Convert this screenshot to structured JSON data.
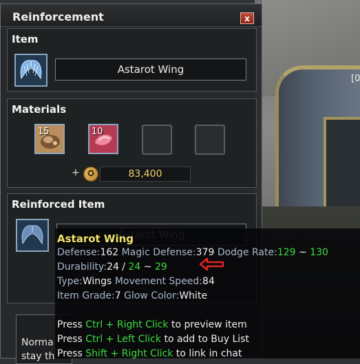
{
  "scene": {
    "corner_mark": "[0"
  },
  "window": {
    "title": "Reinforcement",
    "close_label": "x"
  },
  "item_section": {
    "title": "Item",
    "item_name": "Astarot Wing"
  },
  "materials_section": {
    "title": "Materials",
    "slots": [
      {
        "count": "15",
        "icon": "ore-icon"
      },
      {
        "count": "10",
        "icon": "crystal-icon"
      },
      {
        "count": "",
        "icon": "empty"
      },
      {
        "count": "",
        "icon": "empty"
      }
    ],
    "plus": "+",
    "cost": "83,400"
  },
  "reinforced_section": {
    "title": "Reinforced Item",
    "item_name": "Astarot Wing"
  },
  "bottom": {
    "line1": "Norma",
    "line2": "stay th"
  },
  "tooltip": {
    "title": "Astarot Wing",
    "defense_label": "Defense:",
    "defense_value": "162",
    "magic_defense_label": "Magic Defense:",
    "magic_defense_value": "379",
    "dodge_label": "Dodge Rate:",
    "dodge_min": "129",
    "dodge_sep": " ~ ",
    "dodge_max": "130",
    "durability_label": "Durability:",
    "durability_current": "24",
    "durability_sep": " / ",
    "durability_min": "24",
    "durability_tilde": " ~ ",
    "durability_max": "29",
    "type_label": "Type:",
    "type_value": "Wings",
    "move_speed_label": "Movement Speed:",
    "move_speed_value": "84",
    "grade_label": "Item Grade:",
    "grade_value": "7",
    "glow_label": "Glow Color:",
    "glow_value": "White",
    "hint1_pre": "Press ",
    "hint1_key": "Ctrl + Right Click",
    "hint1_post": " to preview item",
    "hint2_pre": "Press ",
    "hint2_key": "Ctrl + Left Click",
    "hint2_post": " to add to Buy List",
    "hint3_pre": "Press ",
    "hint3_key": "Shift + Right Click",
    "hint3_post": " to link in chat"
  },
  "colors": {
    "title_yellow": "#f3e46a",
    "value_green": "#3ddd3d",
    "label_blue": "#a9b8c9",
    "gold": "#f3d36b",
    "arrow_red": "#e52222"
  }
}
